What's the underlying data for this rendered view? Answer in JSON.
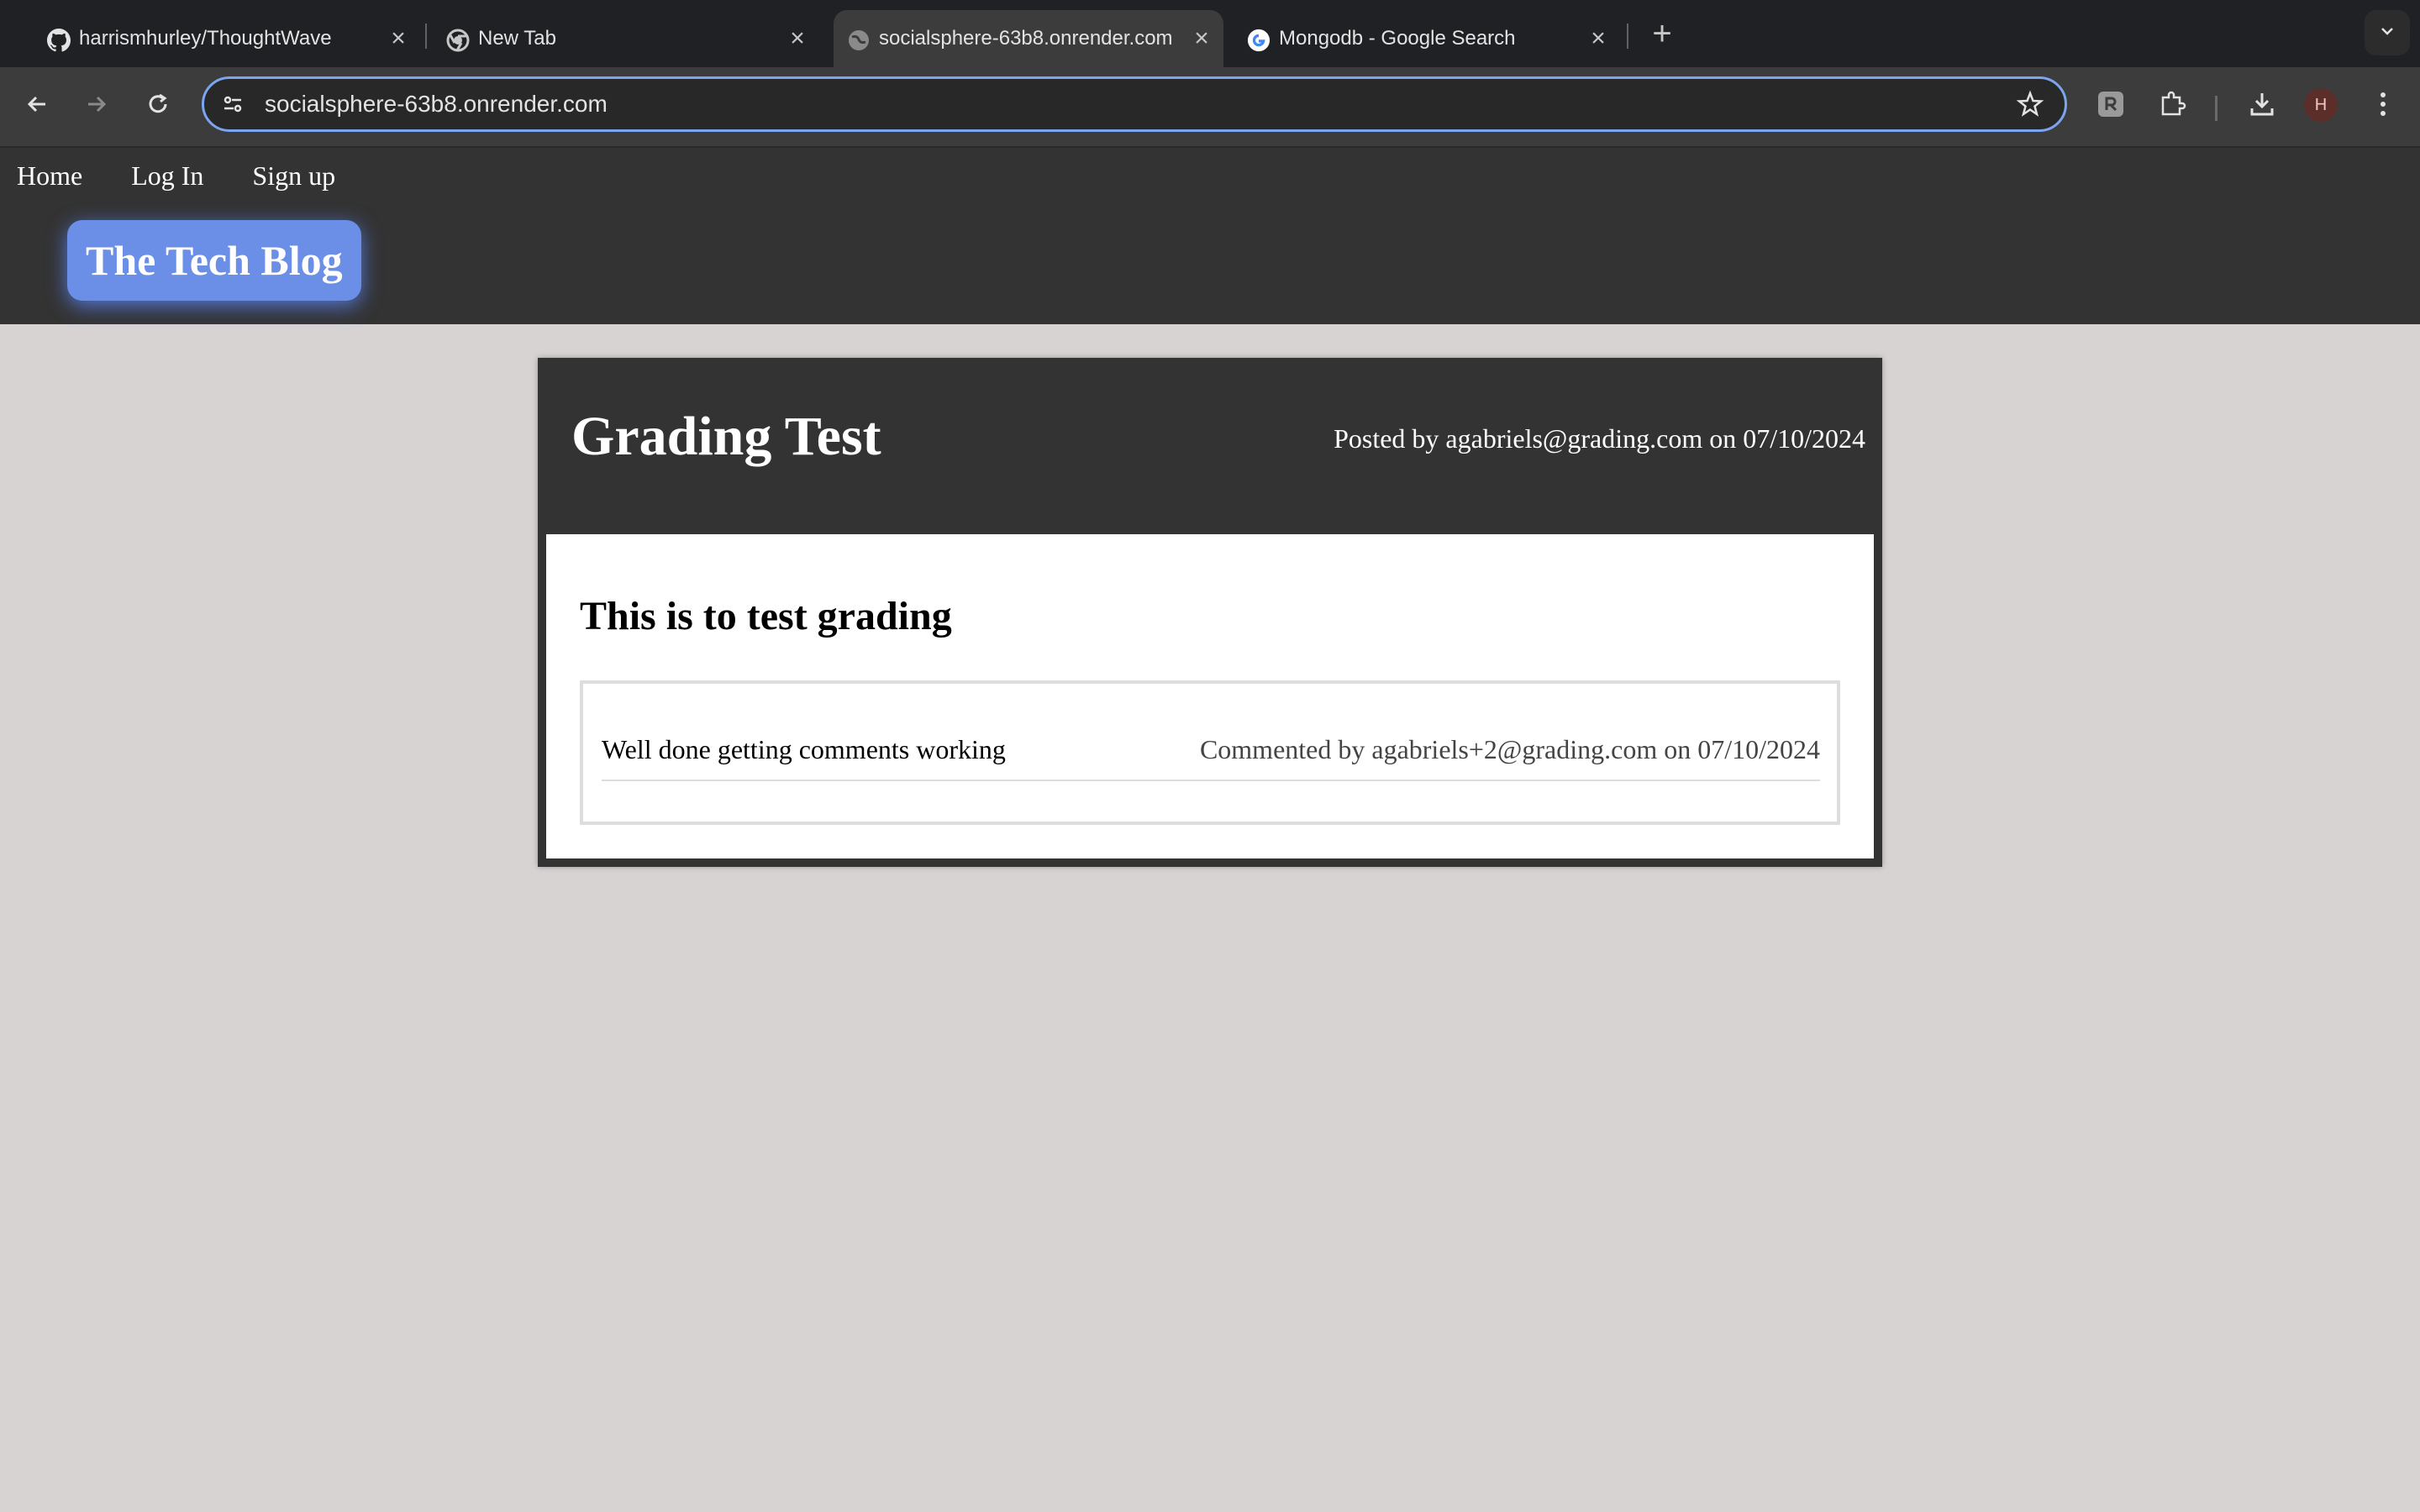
{
  "browser": {
    "tabs": [
      {
        "title": "harrismhurley/ThoughtWave",
        "icon": "github-icon",
        "active": false
      },
      {
        "title": "New Tab",
        "icon": "chrome-icon",
        "active": false
      },
      {
        "title": "socialsphere-63b8.onrender.com",
        "icon": "globe-icon",
        "active": true
      },
      {
        "title": "Mongodb - Google Search",
        "icon": "google-icon",
        "active": false
      }
    ],
    "url": "socialsphere-63b8.onrender.com",
    "profile_initial": "H",
    "accent_color": "#7ca5f0"
  },
  "site": {
    "nav": [
      "Home",
      "Log In",
      "Sign up"
    ],
    "brand": "The Tech Blog",
    "brand_color": "#6b8fe6"
  },
  "post": {
    "title": "Grading Test",
    "meta": "Posted by agabriels@grading.com on 07/10/2024",
    "content": "This is to test grading",
    "comments": [
      {
        "text": "Well done getting comments working",
        "meta": "Commented by agabriels+2@grading.com on 07/10/2024"
      }
    ]
  }
}
